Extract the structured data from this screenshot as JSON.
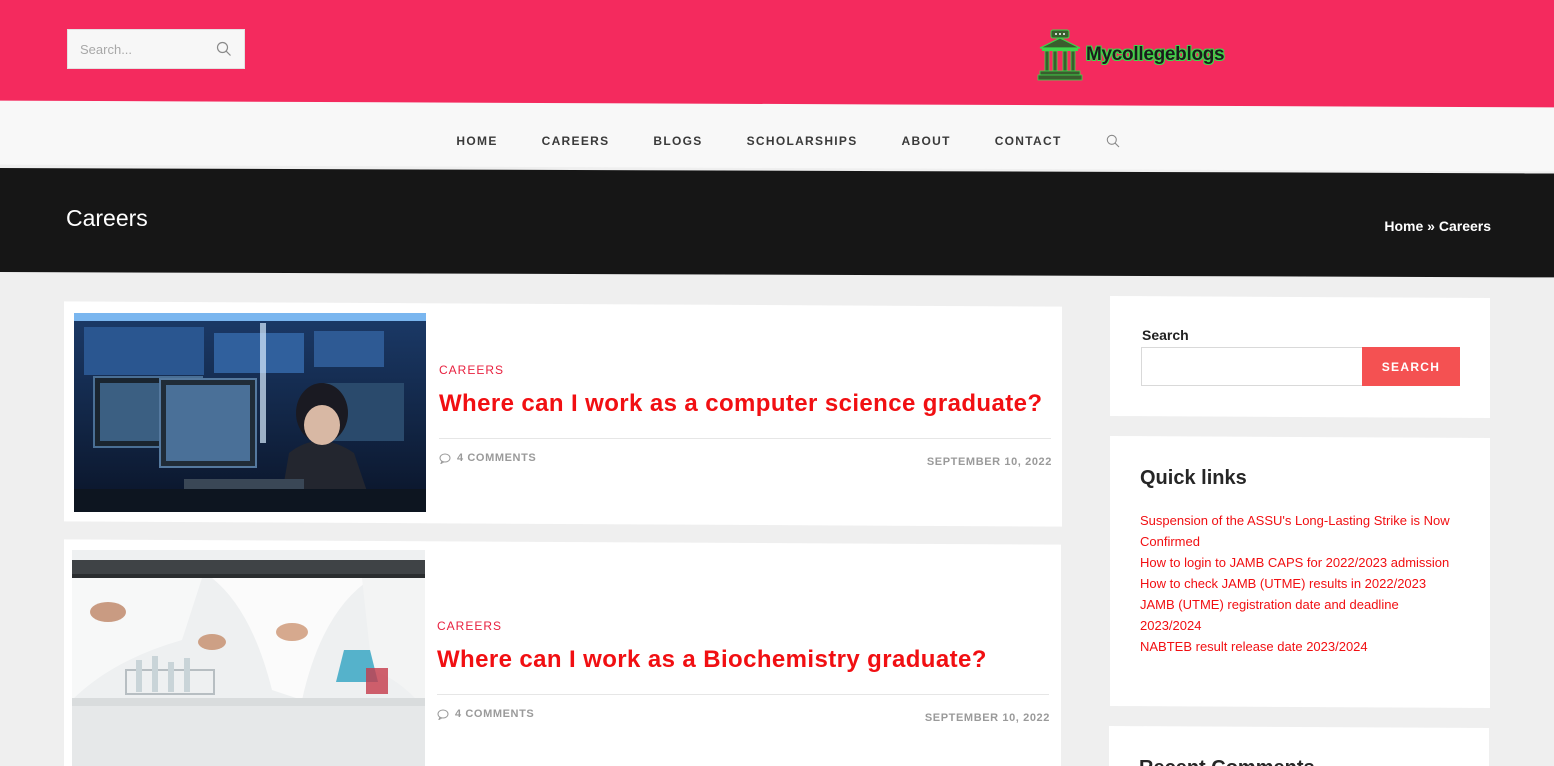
{
  "header": {
    "search_placeholder": "Search...",
    "logo_text": "Mycollegeblogs",
    "brand_color": "#f42a5e"
  },
  "nav": {
    "items": [
      "HOME",
      "CAREERS",
      "BLOGS",
      "SCHOLARSHIPS",
      "ABOUT",
      "CONTACT"
    ]
  },
  "page": {
    "title": "Careers",
    "breadcrumb_home": "Home",
    "breadcrumb_sep": " » ",
    "breadcrumb_current": "Careers"
  },
  "posts": [
    {
      "category": "CAREERS",
      "title": "Where can I work as a computer science graduate?",
      "comments": "4 COMMENTS",
      "date": "SEPTEMBER 10, 2022",
      "image_icon": "office-workers-at-computers-image"
    },
    {
      "category": "CAREERS",
      "title": "Where can I work as a Biochemistry graduate?",
      "comments": "4 COMMENTS",
      "date": "SEPTEMBER 10, 2022",
      "image_icon": "lab-scientists-image"
    }
  ],
  "sidebar": {
    "search_label": "Search",
    "search_button": "SEARCH",
    "quick_links_title": "Quick links",
    "quick_links": [
      "Suspension of the ASSU's Long-Lasting Strike is Now Confirmed",
      "How to login to JAMB CAPS for 2022/2023 admission",
      "How to check JAMB (UTME) results in 2022/2023",
      "JAMB (UTME) registration date and deadline 2023/2024",
      "NABTEB result release date 2023/2024"
    ],
    "recent_comments_title": "Recent Comments"
  }
}
